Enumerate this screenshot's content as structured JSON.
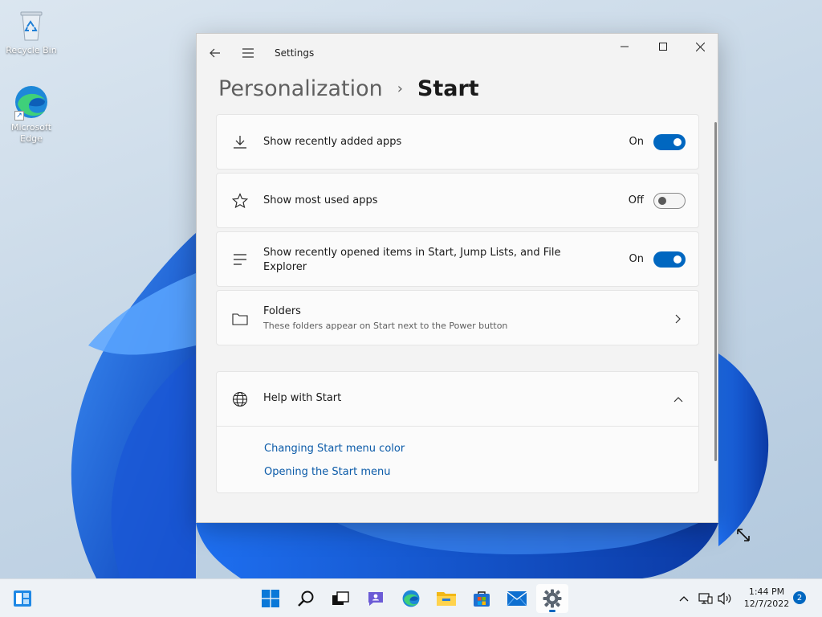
{
  "desktop": {
    "icons": [
      {
        "label": "Recycle Bin"
      },
      {
        "label": "Microsoft Edge"
      }
    ]
  },
  "window": {
    "title": "Settings",
    "breadcrumb": {
      "parent": "Personalization",
      "separator": "›",
      "current": "Start"
    },
    "settings": [
      {
        "label": "Show recently added apps",
        "state": "On",
        "enabled": true,
        "icon": "download-icon"
      },
      {
        "label": "Show most used apps",
        "state": "Off",
        "enabled": false,
        "icon": "star-icon"
      },
      {
        "label": "Show recently opened items in Start, Jump Lists, and File Explorer",
        "state": "On",
        "enabled": true,
        "icon": "list-icon"
      }
    ],
    "folders": {
      "label": "Folders",
      "description": "These folders appear on Start next to the Power button",
      "icon": "folder-icon"
    },
    "help": {
      "title": "Help with Start",
      "icon": "globe-icon",
      "links": [
        "Changing Start menu color",
        "Opening the Start menu"
      ]
    }
  },
  "taskbar": {
    "apps": [
      "start-icon",
      "search-icon",
      "task-view-icon",
      "chat-icon",
      "edge-icon",
      "file-explorer-icon",
      "store-icon",
      "mail-icon",
      "settings-icon"
    ],
    "active_app": "settings-icon",
    "clock": {
      "time": "1:44 PM",
      "date": "12/7/2022"
    },
    "notification_count": "2"
  },
  "colors": {
    "accent": "#0067c0",
    "link": "#0a5aa8",
    "window_bg": "#f3f3f3",
    "card_bg": "#fbfbfb"
  }
}
